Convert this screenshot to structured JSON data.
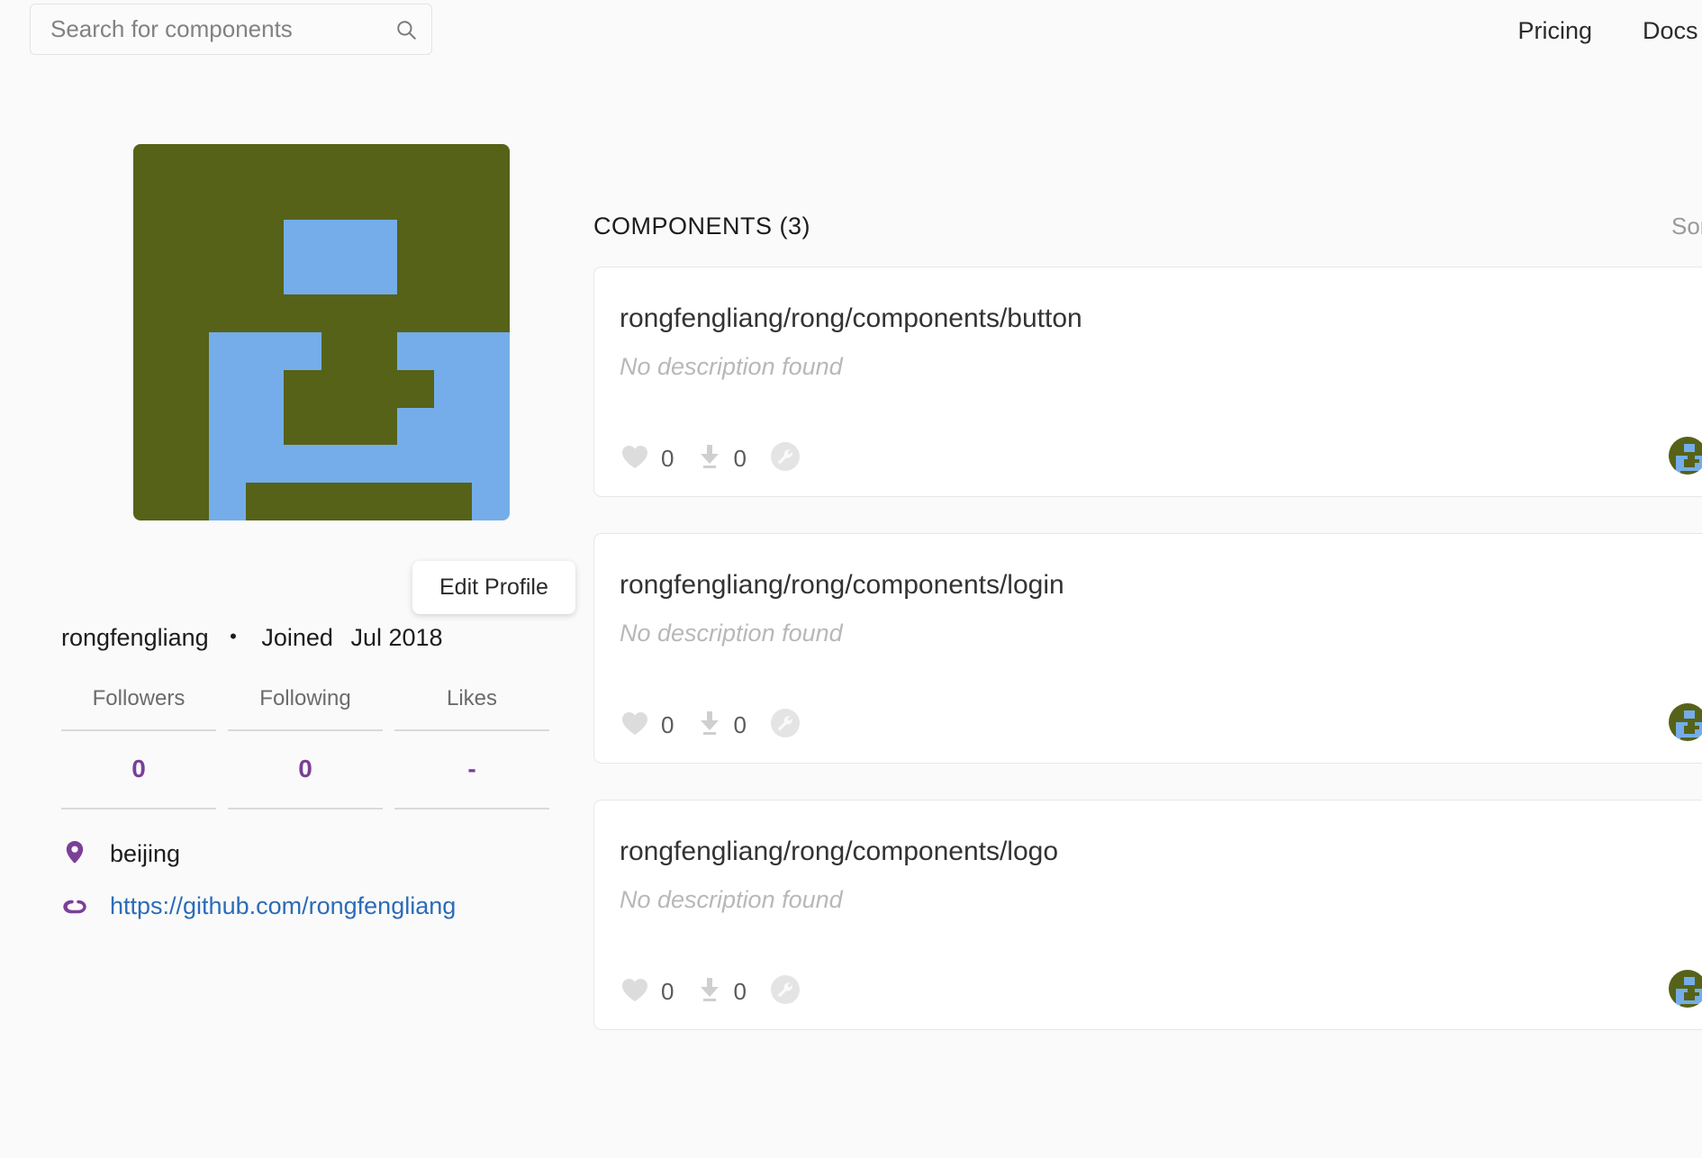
{
  "header": {
    "search": {
      "placeholder": "Search for components",
      "value": "",
      "icon": "search-icon"
    },
    "nav": [
      {
        "label": "Pricing"
      },
      {
        "label": "Docs"
      }
    ]
  },
  "profile": {
    "avatar": {
      "icon": "identicon-avatar",
      "bg_color": "#566218",
      "fg_color": "#74ade9",
      "grid": [
        [
          0,
          0,
          0,
          0,
          0,
          0,
          0,
          0,
          0,
          0
        ],
        [
          0,
          0,
          0,
          0,
          0,
          0,
          0,
          0,
          0,
          0
        ],
        [
          0,
          0,
          0,
          0,
          1,
          1,
          1,
          0,
          0,
          0
        ],
        [
          0,
          0,
          0,
          0,
          1,
          1,
          1,
          0,
          0,
          0
        ],
        [
          0,
          0,
          0,
          0,
          0,
          0,
          0,
          0,
          0,
          0
        ],
        [
          0,
          0,
          1,
          1,
          1,
          0,
          0,
          1,
          1,
          1
        ],
        [
          0,
          0,
          1,
          1,
          0,
          0,
          0,
          0,
          1,
          1
        ],
        [
          0,
          0,
          1,
          1,
          0,
          0,
          0,
          1,
          1,
          1
        ],
        [
          0,
          0,
          1,
          1,
          1,
          1,
          1,
          1,
          1,
          1
        ],
        [
          0,
          0,
          1,
          0,
          0,
          0,
          0,
          0,
          0,
          1
        ]
      ]
    },
    "edit_profile_label": "Edit Profile",
    "username": "rongfengliang",
    "separator": "•",
    "joined_label": "Joined",
    "joined_date": "Jul 2018",
    "stats": [
      {
        "label": "Followers",
        "value": "0"
      },
      {
        "label": "Following",
        "value": "0"
      },
      {
        "label": "Likes",
        "value": "-"
      }
    ],
    "location": {
      "icon": "map-pin-icon",
      "text": "beijing"
    },
    "link": {
      "icon": "link-icon",
      "text": "https://github.com/rongfengliang"
    }
  },
  "main": {
    "components_heading": "COMPONENTS (3)",
    "sort_label": "Sort by",
    "cards": [
      {
        "title": "rongfengliang/rong/components/button",
        "description": "No description found",
        "likes": "0",
        "downloads": "0",
        "build_icon": "wrench-circle-icon",
        "owner_avatar": "identicon-avatar"
      },
      {
        "title": "rongfengliang/rong/components/login",
        "description": "No description found",
        "likes": "0",
        "downloads": "0",
        "build_icon": "wrench-circle-icon",
        "owner_avatar": "identicon-avatar"
      },
      {
        "title": "rongfengliang/rong/components/logo",
        "description": "No description found",
        "likes": "0",
        "downloads": "0",
        "build_icon": "wrench-circle-icon",
        "owner_avatar": "identicon-avatar"
      }
    ]
  },
  "colors": {
    "page_bg": "#fafafa",
    "accent_purple": "#7b3f98",
    "link_blue": "#2b6cb8",
    "avatar_green": "#566218",
    "avatar_blue": "#74ade9"
  }
}
